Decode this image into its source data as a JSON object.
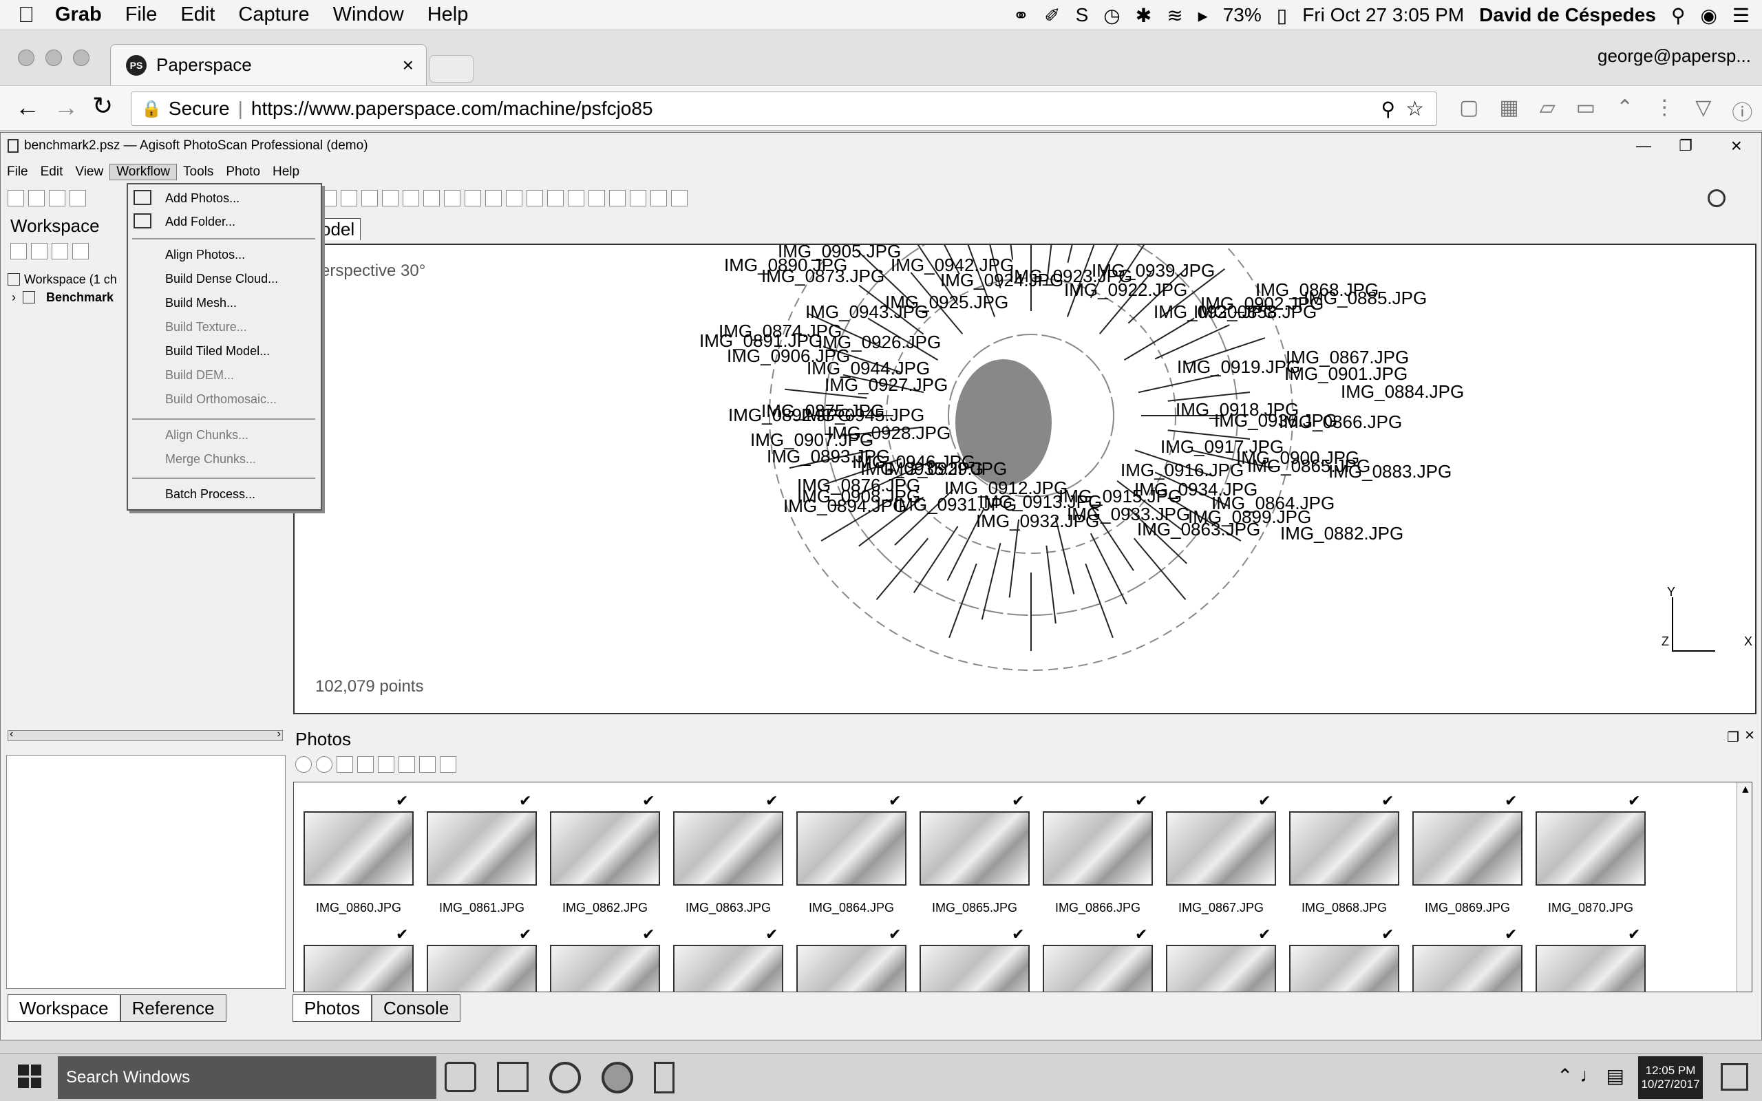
{
  "mac_menubar": {
    "app": "Grab",
    "items": [
      "File",
      "Edit",
      "Capture",
      "Window",
      "Help"
    ],
    "battery": "73%",
    "datetime": "Fri Oct 27  3:05 PM",
    "user": "David de Céspedes"
  },
  "browser": {
    "tab_title": "Paperspace",
    "tab_icon_text": "PS",
    "account": "george@papersp...",
    "secure_label": "Secure",
    "url": "https://www.paperspace.com/machine/psfcjo85"
  },
  "photoscan": {
    "window_title": "benchmark2.psz — Agisoft PhotoScan Professional (demo)",
    "menu": [
      "File",
      "Edit",
      "View",
      "Workflow",
      "Tools",
      "Photo",
      "Help"
    ],
    "workspace_header": "Workspace",
    "workspace_root": "Workspace (1 ch",
    "workspace_child": "Benchmark",
    "model_tab": "odel",
    "viewport_mode": "erspective 30°",
    "point_count": "102,079 points",
    "axis_y": "Y",
    "axis_z": "Z",
    "axis_x": "X",
    "workflow_menu": [
      {
        "label": "Add Photos...",
        "enabled": true
      },
      {
        "label": "Add Folder...",
        "enabled": true
      },
      {
        "label": "Align Photos...",
        "enabled": true
      },
      {
        "label": "Build Dense Cloud...",
        "enabled": true
      },
      {
        "label": "Build Mesh...",
        "enabled": true
      },
      {
        "label": "Build Texture...",
        "enabled": false
      },
      {
        "label": "Build Tiled Model...",
        "enabled": true
      },
      {
        "label": "Build DEM...",
        "enabled": false
      },
      {
        "label": "Build Orthomosaic...",
        "enabled": false
      },
      {
        "label": "Align Chunks...",
        "enabled": false
      },
      {
        "label": "Merge Chunks...",
        "enabled": false
      },
      {
        "label": "Batch Process...",
        "enabled": true
      }
    ],
    "camera_labels": [
      "IMG_0905.JPG",
      "IMG_0890.JPG",
      "IMG_0873.JPG",
      "IMG_0942.JPG",
      "IMG_0924.JPG",
      "IMG_0923.JPG",
      "IMG_0939.JPG",
      "IMG_0922.JPG",
      "IMG_0868.JPG",
      "IMG_0885.JPG",
      "IMG_0925.JPG",
      "IMG_0902.JPG",
      "IMG_0943.JPG",
      "IMG_0920.JPG",
      "IMG_0858.JPG",
      "IMG_0874.JPG",
      "IMG_0891.JPG",
      "IMG_0926.JPG",
      "IMG_0867.JPG",
      "IMG_0906.JPG",
      "IMG_0944.JPG",
      "IMG_0919.JPG",
      "IMG_0901.JPG",
      "IMG_0927.JPG",
      "IMG_0884.JPG",
      "IMG_0875.JPG",
      "IMG_0892.JPG",
      "IMG_0945.JPG",
      "IMG_0918.JPG",
      "IMG_0936.JPG",
      "IMG_0866.JPG",
      "IMG_0928.JPG",
      "IMG_0907.JPG",
      "IMG_0917.JPG",
      "IMG_0893.JPG",
      "IMG_0946.JPG",
      "IMG_0935.JPG",
      "IMG_0900.JPG",
      "IMG_0865.JPG",
      "IMG_0929.JPG",
      "IMG_0916.JPG",
      "IMG_0883.JPG",
      "IMG_0876.JPG",
      "IMG_0912.JPG",
      "IMG_0934.JPG",
      "IMG_0908.JPG",
      "IMG_0915.JPG",
      "IMG_0931.JPG",
      "IMG_0913.JPG",
      "IMG_0864.JPG",
      "IMG_0894.JPG",
      "IMG_0933.JPG",
      "IMG_0899.JPG",
      "IMG_0932.JPG",
      "IMG_0863.JPG",
      "IMG_0882.JPG"
    ],
    "photos_header": "Photos",
    "photos_row1": [
      "IMG_0860.JPG",
      "IMG_0861.JPG",
      "IMG_0862.JPG",
      "IMG_0863.JPG",
      "IMG_0864.JPG",
      "IMG_0865.JPG",
      "IMG_0866.JPG",
      "IMG_0867.JPG",
      "IMG_0868.JPG",
      "IMG_0869.JPG",
      "IMG_0870.JPG"
    ],
    "left_tabs": [
      "Workspace",
      "Reference"
    ],
    "bottom_tabs": [
      "Photos",
      "Console"
    ]
  },
  "taskbar": {
    "search_placeholder": "Search Windows",
    "time": "12:05 PM",
    "date": "10/27/2017"
  }
}
